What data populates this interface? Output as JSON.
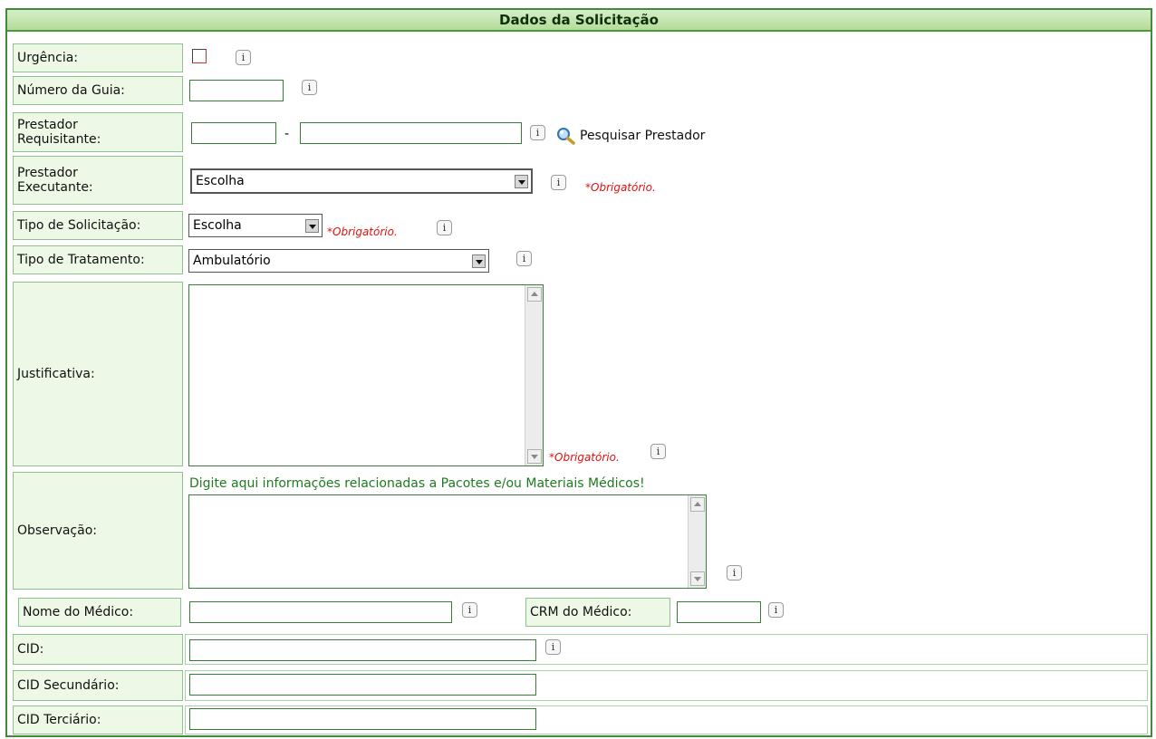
{
  "section_title": "Dados da Solicitação",
  "info_glyph": "i",
  "required_text": "*Obrigatório.",
  "fields": {
    "urgencia": {
      "label": "Urgência:",
      "checked": false
    },
    "numero_guia": {
      "label": "Número da Guia:",
      "value": ""
    },
    "prestador_requisitante": {
      "label_line1": "Prestador",
      "label_line2": "Requisitante:",
      "code_value": "",
      "separator": "-",
      "name_value": "",
      "search_link": "Pesquisar Prestador",
      "search_icon": "magnifier-icon"
    },
    "prestador_executante": {
      "label_line1": "Prestador",
      "label_line2": "Executante:",
      "selected": "Escolha"
    },
    "tipo_solicitacao": {
      "label": "Tipo de Solicitação:",
      "selected": "Escolha"
    },
    "tipo_tratamento": {
      "label": "Tipo de Tratamento:",
      "selected": "Ambulatório"
    },
    "justificativa": {
      "label": "Justificativa:",
      "value": ""
    },
    "observacao": {
      "label": "Observação:",
      "hint": "Digite aqui informações relacionadas a Pacotes e/ou Materiais Médicos!",
      "value": ""
    },
    "nome_medico": {
      "label": "Nome do Médico:",
      "value": ""
    },
    "crm_medico": {
      "label": "CRM do Médico:",
      "value": ""
    },
    "cid": {
      "label": "CID:",
      "value": ""
    },
    "cid_secundario": {
      "label": "CID Secundário:",
      "value": ""
    },
    "cid_terciario": {
      "label": "CID Terciário:",
      "value": ""
    }
  },
  "colors": {
    "border_green": "#3f8a3f",
    "label_bg": "#edf8e6",
    "header_bg": "#b4dc98",
    "required_red": "#e01010",
    "hint_green": "#1f7a1f"
  }
}
